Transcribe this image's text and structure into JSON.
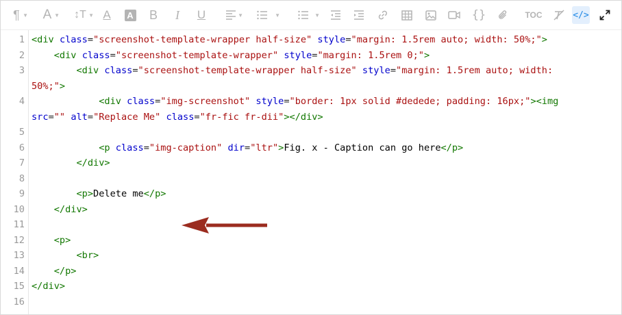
{
  "toolbar": {
    "buttons": [
      {
        "name": "paragraph-format-icon",
        "glyph": "¶",
        "dropdown": true
      },
      {
        "name": "font-family-icon",
        "glyph": "A",
        "dropdown": true
      },
      {
        "name": "font-size-icon",
        "glyph": "⇕T",
        "dropdown": true
      },
      {
        "name": "text-color-icon",
        "glyph": "A"
      },
      {
        "name": "background-color-icon",
        "glyph": "A"
      },
      {
        "name": "bold-icon",
        "glyph": "B"
      },
      {
        "name": "italic-icon",
        "glyph": "I"
      },
      {
        "name": "underline-icon",
        "glyph": "U"
      },
      {
        "name": "align-icon",
        "glyph": "≡",
        "dropdown": true
      },
      {
        "name": "ordered-list-icon",
        "glyph": "☰",
        "dropdown": true
      },
      {
        "name": "unordered-list-icon",
        "glyph": "☰",
        "dropdown": true
      },
      {
        "name": "outdent-icon",
        "glyph": "⇤"
      },
      {
        "name": "indent-icon",
        "glyph": "⇥"
      },
      {
        "name": "link-icon",
        "glyph": "🔗"
      },
      {
        "name": "table-icon",
        "glyph": "▦"
      },
      {
        "name": "image-icon",
        "glyph": "▣"
      },
      {
        "name": "video-icon",
        "glyph": "▶"
      },
      {
        "name": "code-block-icon",
        "glyph": "{}"
      },
      {
        "name": "attachment-icon",
        "glyph": "📎"
      },
      {
        "name": "toc-icon",
        "glyph": "TOC"
      },
      {
        "name": "clear-formatting-icon",
        "glyph": "⌫"
      },
      {
        "name": "code-view-icon",
        "glyph": "</>",
        "active": true
      },
      {
        "name": "fullscreen-icon",
        "glyph": "⤢"
      }
    ]
  },
  "editor": {
    "line_numbers": [
      "1",
      "2",
      "3",
      "4",
      "5",
      "6",
      "7",
      "8",
      "9",
      "10",
      "11",
      "12",
      "13",
      "14",
      "15",
      "16"
    ]
  },
  "colors": {
    "tag": "#117700",
    "attribute": "#0000cc",
    "string": "#aa1111",
    "arrow": "#9b2c1f",
    "active_button": "#1e88e5"
  }
}
